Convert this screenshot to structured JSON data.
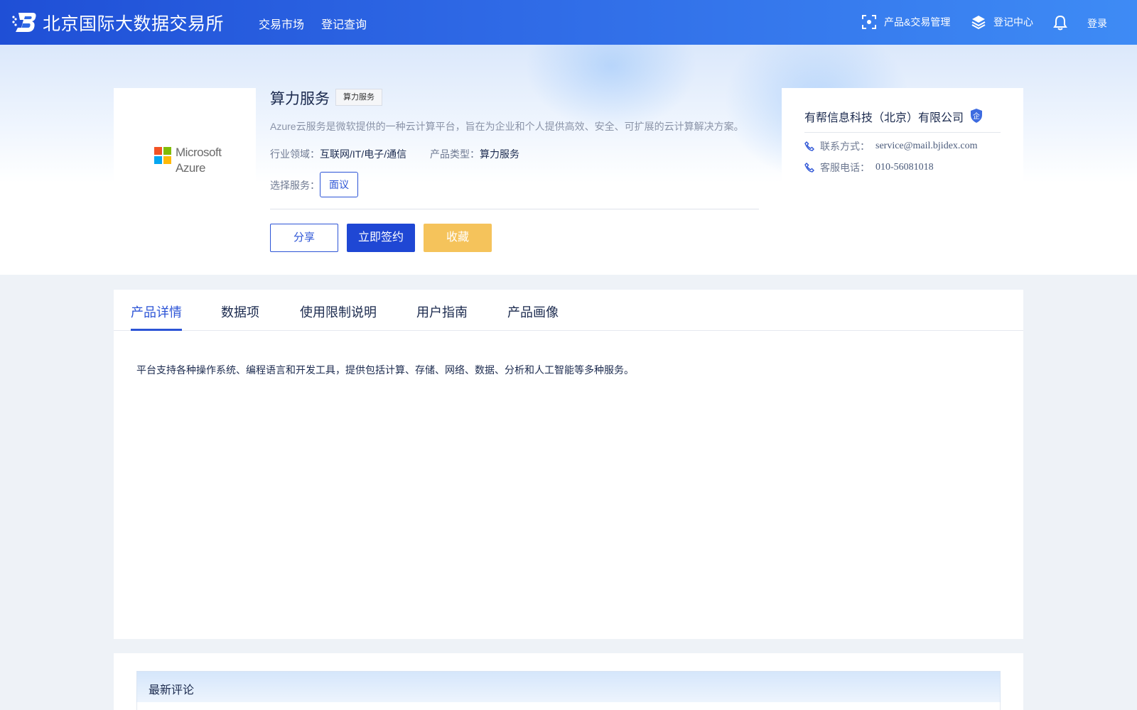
{
  "header": {
    "brand": "北京国际大数据交易所",
    "nav": [
      "交易市场",
      "登记查询"
    ],
    "product_mgmt": "产品&交易管理",
    "register_center": "登记中心",
    "login": "登录"
  },
  "product": {
    "logo_text": [
      "Microsoft",
      "Azure"
    ],
    "title": "算力服务",
    "tag": "算力服务",
    "description": "Azure云服务是微软提供的一种云计算平台，旨在为企业和个人提供高效、安全、可扩展的云计算解决方案。",
    "industry_label": "行业领域：",
    "industry_value": "互联网/IT/电子/通信",
    "type_label": "产品类型：",
    "type_value": "算力服务",
    "select_label": "选择服务：",
    "select_option": "面议",
    "buttons": {
      "share": "分享",
      "sign": "立即签约",
      "favorite": "收藏"
    }
  },
  "company": {
    "name": "有帮信息科技（北京）有限公司",
    "badge": "企",
    "contact_label": "联系方式：",
    "contact_value": "service@mail.bjidex.com",
    "phone_label": "客服电话：",
    "phone_value": "010-56081018"
  },
  "tabs": [
    "产品详情",
    "数据项",
    "使用限制说明",
    "用户指南",
    "产品画像"
  ],
  "active_tab": 0,
  "detail_text": "平台支持各种操作系统、编程语言和开发工具，提供包括计算、存储、网络、数据、分析和人工智能等多种服务。",
  "comments": {
    "title": "最新评论"
  },
  "colors": {
    "primary": "#1f47d4",
    "accent_blue": "#2c54d6",
    "favorite": "#f5c35b"
  }
}
